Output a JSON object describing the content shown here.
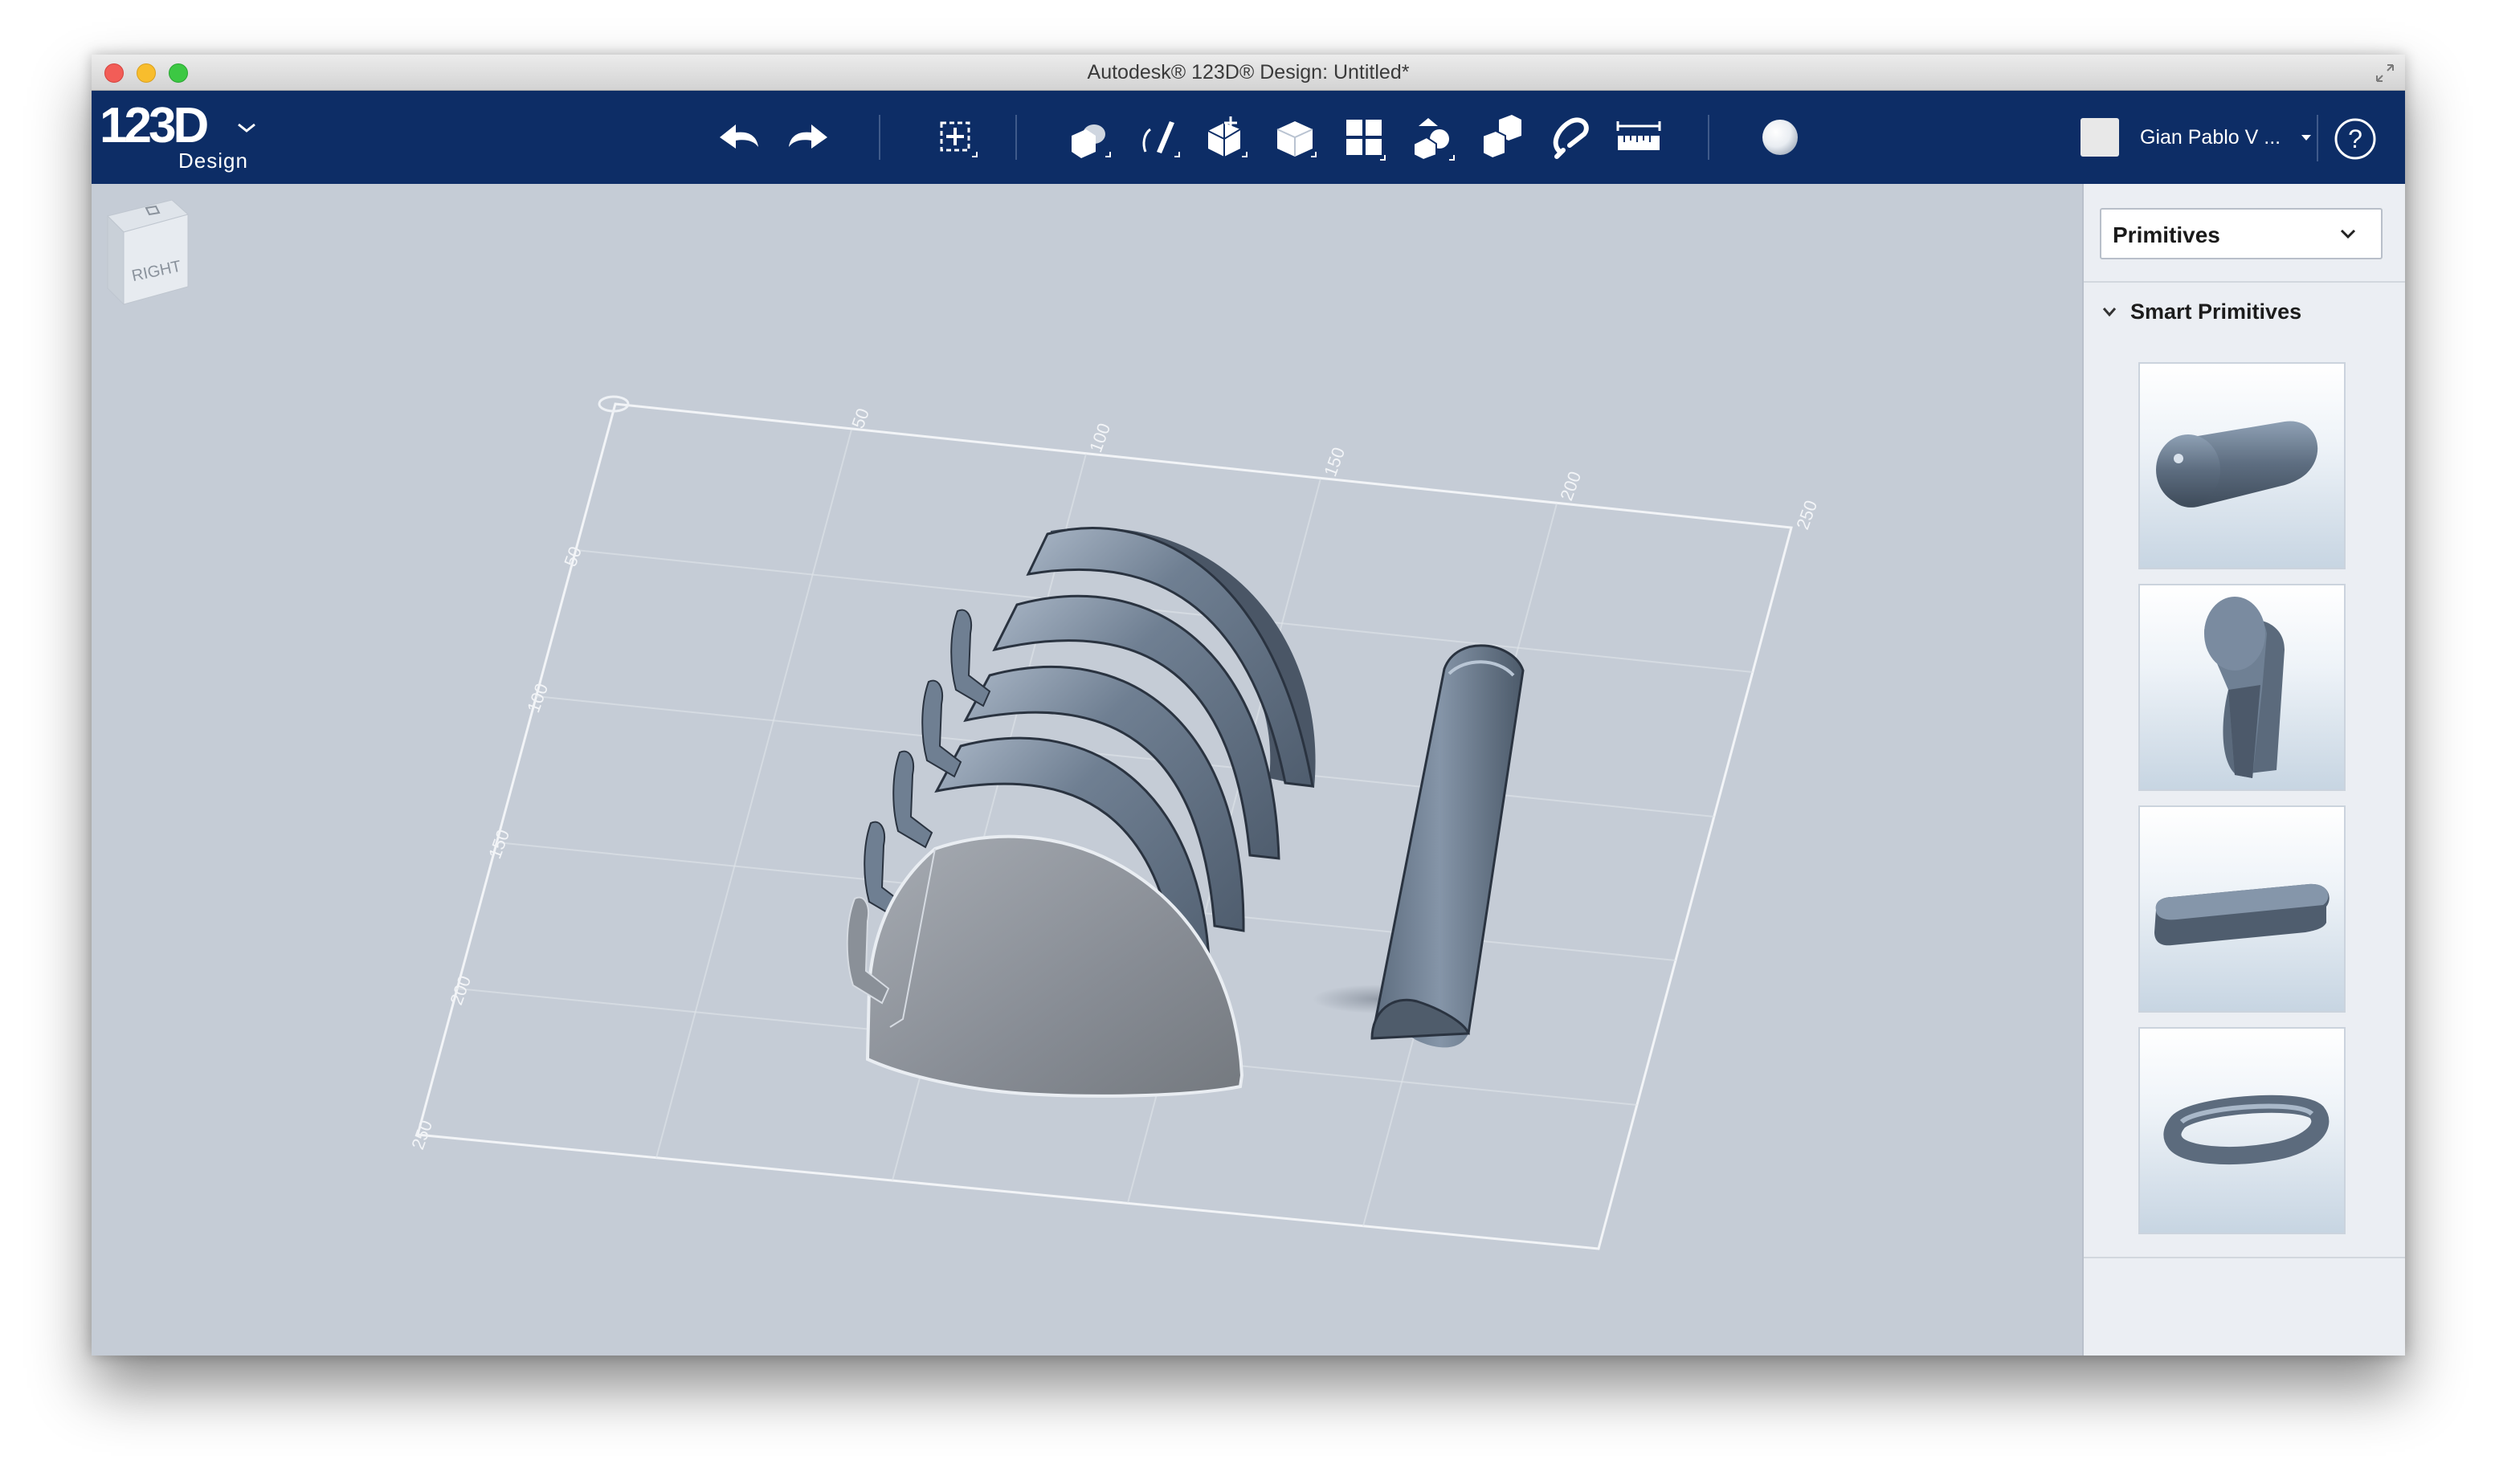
{
  "window": {
    "title": "Autodesk® 123D® Design: Untitled*"
  },
  "logo": {
    "text": "123D",
    "subtitle": "Design"
  },
  "toolbar": {
    "icons": [
      "undo-icon",
      "redo-icon",
      "transform-icon",
      "primitives-icon",
      "sketch-icon",
      "construct-icon",
      "modify-icon",
      "pattern-icon",
      "grouping-icon",
      "combine-icon",
      "snap-icon",
      "measure-icon",
      "material-icon"
    ]
  },
  "user": {
    "name": "Gian Pablo V ..."
  },
  "grid": {
    "top_labels": [
      "50",
      "100",
      "150",
      "200",
      "250"
    ],
    "left_labels": [
      "50",
      "100",
      "150",
      "200",
      "250"
    ]
  },
  "viewcube": {
    "face_label": "RIGHT"
  },
  "panel": {
    "category": "Primitives",
    "section": "Smart Primitives",
    "items": [
      "capsule-primitive",
      "keyhole-primitive",
      "slot-primitive",
      "ring-slot-primitive"
    ]
  },
  "colors": {
    "toolbar_bg": "#0d2d66",
    "viewport_bg": "#c5ccd6",
    "panel_bg": "#ebeef3",
    "model_dark": "#637284",
    "model_light": "#8b9097"
  }
}
